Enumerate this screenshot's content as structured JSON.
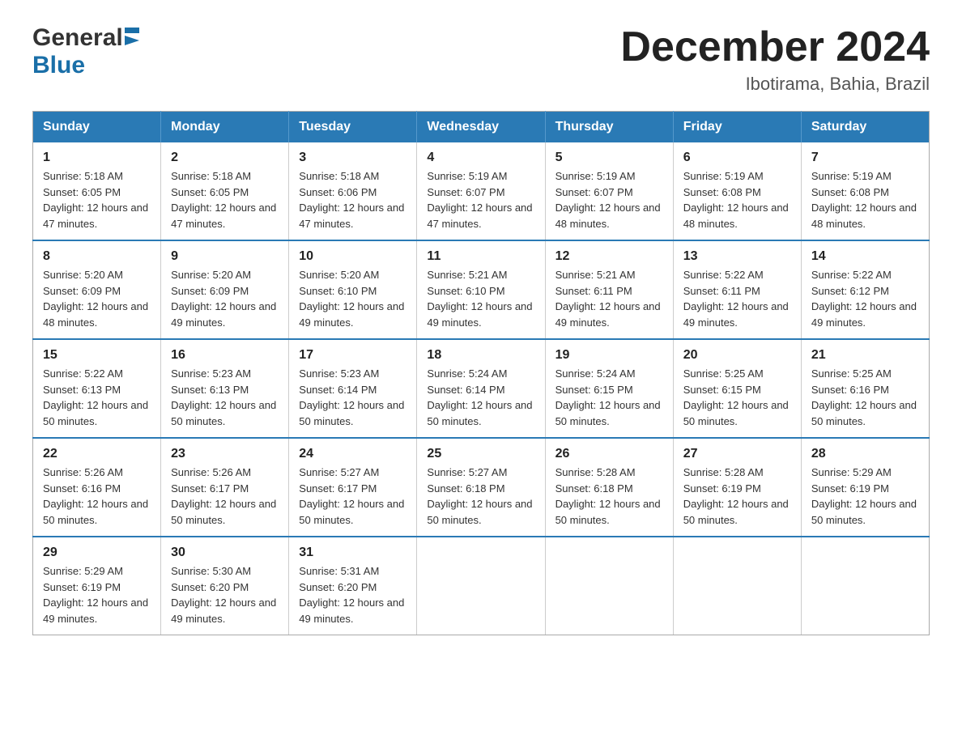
{
  "logo": {
    "general": "General",
    "blue": "Blue"
  },
  "title": {
    "month_year": "December 2024",
    "location": "Ibotirama, Bahia, Brazil"
  },
  "header_days": [
    "Sunday",
    "Monday",
    "Tuesday",
    "Wednesday",
    "Thursday",
    "Friday",
    "Saturday"
  ],
  "weeks": [
    [
      {
        "day": "1",
        "sunrise": "Sunrise: 5:18 AM",
        "sunset": "Sunset: 6:05 PM",
        "daylight": "Daylight: 12 hours and 47 minutes."
      },
      {
        "day": "2",
        "sunrise": "Sunrise: 5:18 AM",
        "sunset": "Sunset: 6:05 PM",
        "daylight": "Daylight: 12 hours and 47 minutes."
      },
      {
        "day": "3",
        "sunrise": "Sunrise: 5:18 AM",
        "sunset": "Sunset: 6:06 PM",
        "daylight": "Daylight: 12 hours and 47 minutes."
      },
      {
        "day": "4",
        "sunrise": "Sunrise: 5:19 AM",
        "sunset": "Sunset: 6:07 PM",
        "daylight": "Daylight: 12 hours and 47 minutes."
      },
      {
        "day": "5",
        "sunrise": "Sunrise: 5:19 AM",
        "sunset": "Sunset: 6:07 PM",
        "daylight": "Daylight: 12 hours and 48 minutes."
      },
      {
        "day": "6",
        "sunrise": "Sunrise: 5:19 AM",
        "sunset": "Sunset: 6:08 PM",
        "daylight": "Daylight: 12 hours and 48 minutes."
      },
      {
        "day": "7",
        "sunrise": "Sunrise: 5:19 AM",
        "sunset": "Sunset: 6:08 PM",
        "daylight": "Daylight: 12 hours and 48 minutes."
      }
    ],
    [
      {
        "day": "8",
        "sunrise": "Sunrise: 5:20 AM",
        "sunset": "Sunset: 6:09 PM",
        "daylight": "Daylight: 12 hours and 48 minutes."
      },
      {
        "day": "9",
        "sunrise": "Sunrise: 5:20 AM",
        "sunset": "Sunset: 6:09 PM",
        "daylight": "Daylight: 12 hours and 49 minutes."
      },
      {
        "day": "10",
        "sunrise": "Sunrise: 5:20 AM",
        "sunset": "Sunset: 6:10 PM",
        "daylight": "Daylight: 12 hours and 49 minutes."
      },
      {
        "day": "11",
        "sunrise": "Sunrise: 5:21 AM",
        "sunset": "Sunset: 6:10 PM",
        "daylight": "Daylight: 12 hours and 49 minutes."
      },
      {
        "day": "12",
        "sunrise": "Sunrise: 5:21 AM",
        "sunset": "Sunset: 6:11 PM",
        "daylight": "Daylight: 12 hours and 49 minutes."
      },
      {
        "day": "13",
        "sunrise": "Sunrise: 5:22 AM",
        "sunset": "Sunset: 6:11 PM",
        "daylight": "Daylight: 12 hours and 49 minutes."
      },
      {
        "day": "14",
        "sunrise": "Sunrise: 5:22 AM",
        "sunset": "Sunset: 6:12 PM",
        "daylight": "Daylight: 12 hours and 49 minutes."
      }
    ],
    [
      {
        "day": "15",
        "sunrise": "Sunrise: 5:22 AM",
        "sunset": "Sunset: 6:13 PM",
        "daylight": "Daylight: 12 hours and 50 minutes."
      },
      {
        "day": "16",
        "sunrise": "Sunrise: 5:23 AM",
        "sunset": "Sunset: 6:13 PM",
        "daylight": "Daylight: 12 hours and 50 minutes."
      },
      {
        "day": "17",
        "sunrise": "Sunrise: 5:23 AM",
        "sunset": "Sunset: 6:14 PM",
        "daylight": "Daylight: 12 hours and 50 minutes."
      },
      {
        "day": "18",
        "sunrise": "Sunrise: 5:24 AM",
        "sunset": "Sunset: 6:14 PM",
        "daylight": "Daylight: 12 hours and 50 minutes."
      },
      {
        "day": "19",
        "sunrise": "Sunrise: 5:24 AM",
        "sunset": "Sunset: 6:15 PM",
        "daylight": "Daylight: 12 hours and 50 minutes."
      },
      {
        "day": "20",
        "sunrise": "Sunrise: 5:25 AM",
        "sunset": "Sunset: 6:15 PM",
        "daylight": "Daylight: 12 hours and 50 minutes."
      },
      {
        "day": "21",
        "sunrise": "Sunrise: 5:25 AM",
        "sunset": "Sunset: 6:16 PM",
        "daylight": "Daylight: 12 hours and 50 minutes."
      }
    ],
    [
      {
        "day": "22",
        "sunrise": "Sunrise: 5:26 AM",
        "sunset": "Sunset: 6:16 PM",
        "daylight": "Daylight: 12 hours and 50 minutes."
      },
      {
        "day": "23",
        "sunrise": "Sunrise: 5:26 AM",
        "sunset": "Sunset: 6:17 PM",
        "daylight": "Daylight: 12 hours and 50 minutes."
      },
      {
        "day": "24",
        "sunrise": "Sunrise: 5:27 AM",
        "sunset": "Sunset: 6:17 PM",
        "daylight": "Daylight: 12 hours and 50 minutes."
      },
      {
        "day": "25",
        "sunrise": "Sunrise: 5:27 AM",
        "sunset": "Sunset: 6:18 PM",
        "daylight": "Daylight: 12 hours and 50 minutes."
      },
      {
        "day": "26",
        "sunrise": "Sunrise: 5:28 AM",
        "sunset": "Sunset: 6:18 PM",
        "daylight": "Daylight: 12 hours and 50 minutes."
      },
      {
        "day": "27",
        "sunrise": "Sunrise: 5:28 AM",
        "sunset": "Sunset: 6:19 PM",
        "daylight": "Daylight: 12 hours and 50 minutes."
      },
      {
        "day": "28",
        "sunrise": "Sunrise: 5:29 AM",
        "sunset": "Sunset: 6:19 PM",
        "daylight": "Daylight: 12 hours and 50 minutes."
      }
    ],
    [
      {
        "day": "29",
        "sunrise": "Sunrise: 5:29 AM",
        "sunset": "Sunset: 6:19 PM",
        "daylight": "Daylight: 12 hours and 49 minutes."
      },
      {
        "day": "30",
        "sunrise": "Sunrise: 5:30 AM",
        "sunset": "Sunset: 6:20 PM",
        "daylight": "Daylight: 12 hours and 49 minutes."
      },
      {
        "day": "31",
        "sunrise": "Sunrise: 5:31 AM",
        "sunset": "Sunset: 6:20 PM",
        "daylight": "Daylight: 12 hours and 49 minutes."
      },
      null,
      null,
      null,
      null
    ]
  ]
}
